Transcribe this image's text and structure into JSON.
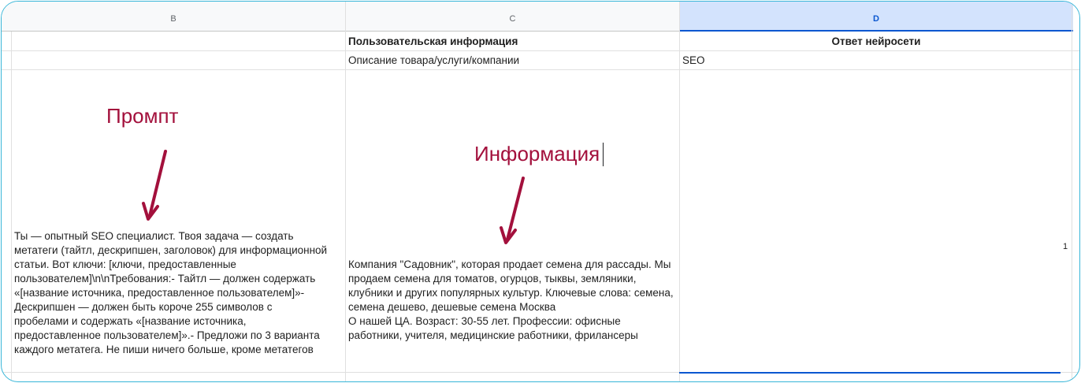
{
  "columns": {
    "b": "B",
    "c": "C",
    "d": "D"
  },
  "row_headers": {
    "c": "Пользовательская информация",
    "d": "Ответ нейросети"
  },
  "row_types": {
    "c": "Описание товара/услуги/компании",
    "d": "SEO"
  },
  "prompt_cell": "Ты — опытный SEO специалист. Твоя задача — создать метатеги (тайтл, дескрипшен, заголовок) для информационной статьи. Вот ключи: [ключи, предоставленные пользователем]\\n\\nТребования:- Тайтл — должен содержать «[название источника, предоставленное пользователем]»- Дескрипшен — должен быть короче 255 символов с пробелами и содержать «[название источника, предоставленное пользователем]».- Предложи по 3 варианта каждого метатега. Не пиши ничего больше, кроме метатегов",
  "info_cell": "Компания \"Садовник\", которая продает семена для рассады. Мы продаем семена для томатов, огурцов, тыквы, земляники, клубники и других популярных культур. Ключевые слова: семена, семена дешево, дешевые семена Москва\nО нашей ЦА. Возраст: 30-55 лет. Профессии: офисные работники, учителя, медицинские работники, фрилансеры",
  "annotations": {
    "prompt": "Промпт",
    "info": "Информация"
  },
  "side_marker": "1",
  "colors": {
    "frame": "#38b6d8",
    "annotation": "#a3103c",
    "selection": "#0b57d0"
  }
}
